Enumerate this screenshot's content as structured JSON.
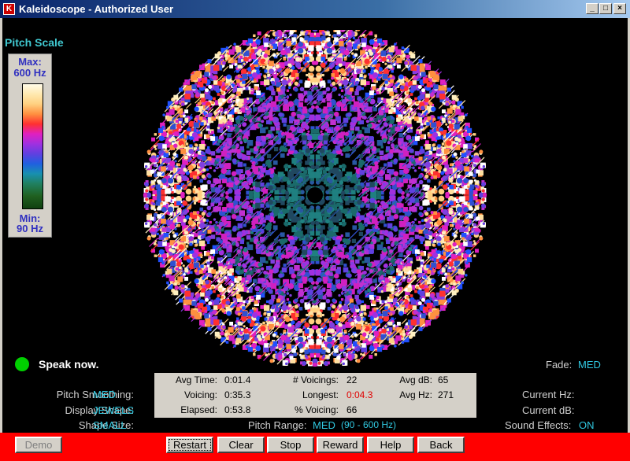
{
  "window": {
    "title": "Kaleidoscope - Authorized User",
    "app_icon": "kaleidoscope-app-icon",
    "controls": [
      "_",
      "□",
      "×"
    ]
  },
  "pitch_scale": {
    "title": "Pitch Scale",
    "max_label": "Max:",
    "max_value": "600 Hz",
    "min_label": "Min:",
    "min_value": "90 Hz"
  },
  "status": {
    "text": "Speak now.",
    "indicator_color": "#00d000"
  },
  "settings": {
    "pitch_smoothing_label": "Pitch Smoothing:",
    "pitch_smoothing_value": "MED",
    "display_shape_label": "Display Shape:",
    "display_shape_value": "JEWELS",
    "shape_size_label": "Shape Size:",
    "shape_size_value": "SMALL",
    "pitch_range_label": "Pitch Range:",
    "pitch_range_value": "MED",
    "pitch_range_hz": "(90 - 600 Hz)",
    "fade_label": "Fade:",
    "fade_value": "MED",
    "current_hz_label": "Current Hz:",
    "current_db_label": "Current dB:",
    "sound_effects_label": "Sound  Effects:",
    "sound_effects_value": "ON"
  },
  "stats": {
    "avg_time_label": "Avg Time:",
    "avg_time": "0:01.4",
    "voicing_label": "Voicing:",
    "voicing": "0:35.3",
    "elapsed_label": "Elapsed:",
    "elapsed": "0:53.8",
    "num_voicings_label": "# Voicings:",
    "num_voicings": "22",
    "longest_label": "Longest:",
    "longest": "0:04.3",
    "pct_voicing_label": "% Voicing:",
    "pct_voicing": "66",
    "avg_db_label": "Avg dB:",
    "avg_db": "65",
    "avg_hz_label": "Avg Hz:",
    "avg_hz": "271"
  },
  "buttons": {
    "demo": "Demo",
    "restart": "Restart",
    "clear": "Clear",
    "stop": "Stop",
    "reward": "Reward",
    "help": "Help",
    "back": "Back"
  },
  "colors": {
    "accent": "#30c8e0",
    "button_bar": "#ff0000",
    "highlight_value": "#e00000"
  }
}
